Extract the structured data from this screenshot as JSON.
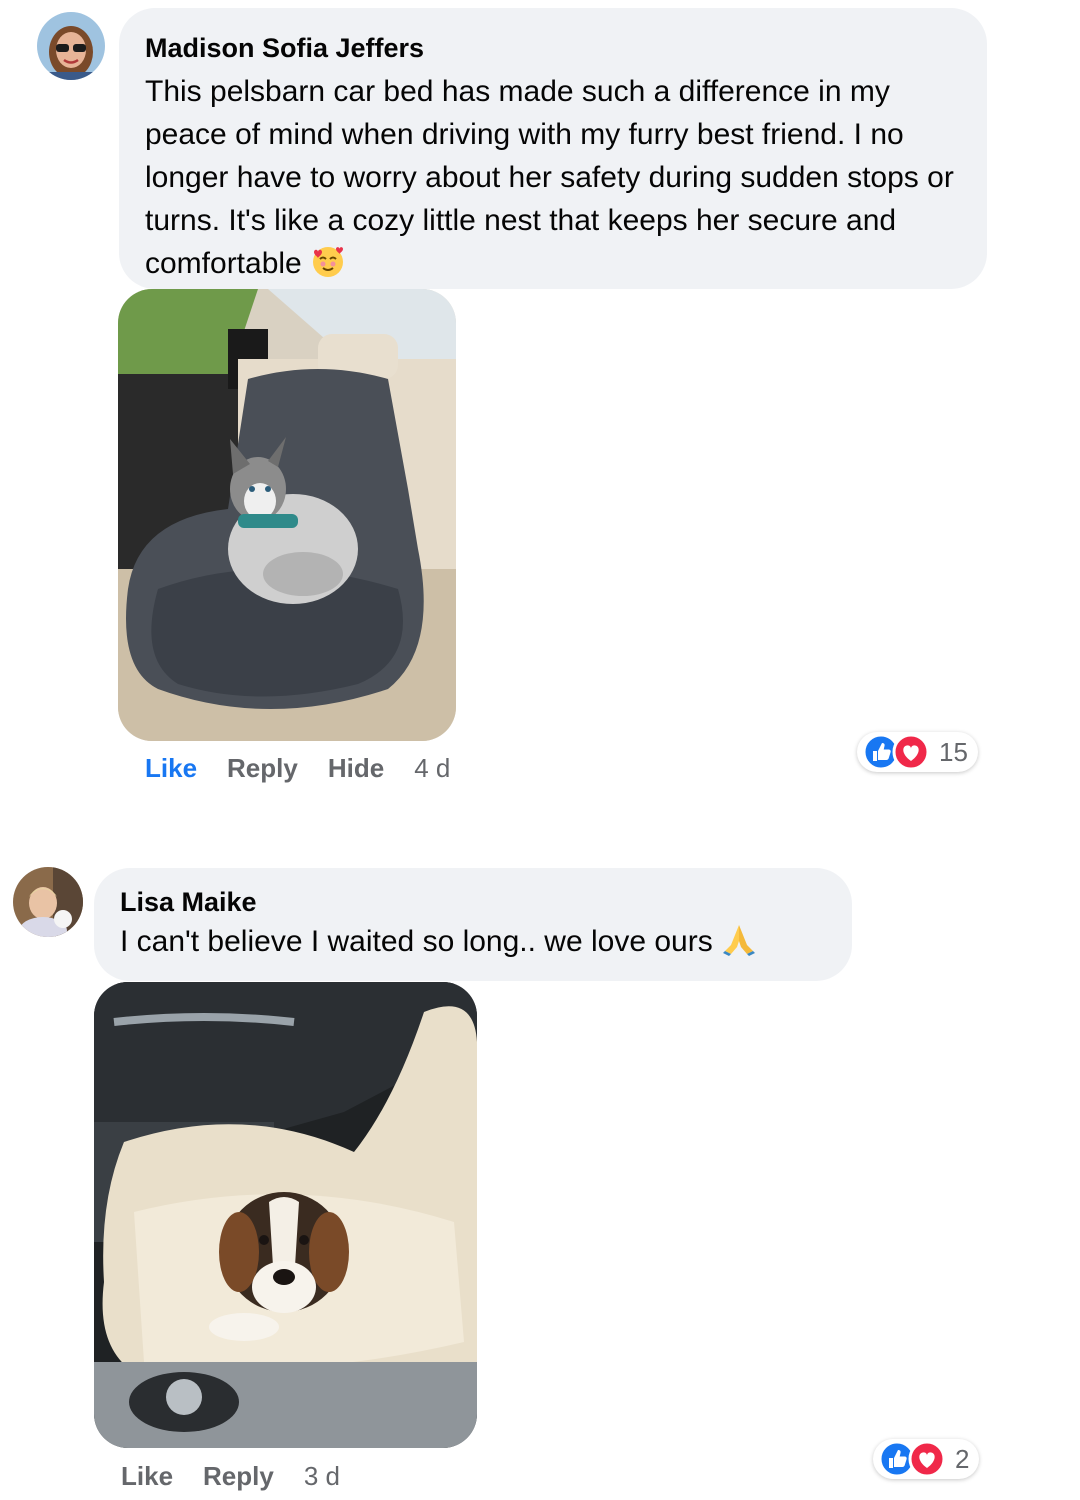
{
  "comments": [
    {
      "author": "Madison Sofia Jeffers",
      "text": "This pelsbarn car bed has made such a difference in my peace of mind when driving with my furry best friend. I no longer have to worry about her safety during sudden stops or turns. It's like a cozy little nest that keeps her secure and comfortable",
      "emoji": "smiling-face-with-hearts",
      "actions": {
        "like": "Like",
        "reply": "Reply",
        "hide": "Hide",
        "time": "4 d"
      },
      "reaction_count": "15",
      "reactions": [
        "like",
        "love"
      ],
      "photo_subject": "husky-puppy-in-gray-fluffy-car-bed"
    },
    {
      "author": "Lisa Maike",
      "text": "I can't believe I waited so long.. we love ours",
      "emoji": "folded-hands",
      "actions": {
        "like": "Like",
        "reply": "Reply",
        "time": "3 d"
      },
      "reaction_count": "2",
      "reactions": [
        "like",
        "love"
      ],
      "photo_subject": "beagle-puppy-in-cream-fluffy-car-bed"
    }
  ],
  "colors": {
    "bubble": "#f0f2f5",
    "like_active": "#1877f2",
    "action_text": "#65676b",
    "love": "#f02849"
  }
}
